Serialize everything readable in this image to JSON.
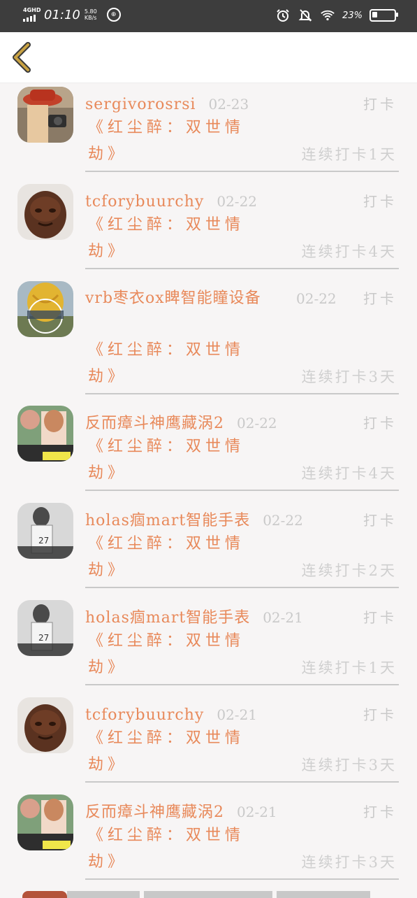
{
  "status_bar": {
    "network": "4GHD",
    "time": "01:10",
    "speed_value": "5.80",
    "speed_unit": "KB/s",
    "battery": "23"
  },
  "header": {
    "back_icon": "chevron-left-icon"
  },
  "entries": [
    {
      "user": "sergivorosrsi",
      "date": "02-23",
      "action": "打卡",
      "book_line1": "《红尘醉：双世情",
      "book_line2": "劫》",
      "streak": "连续打卡1天",
      "avatar": "red-hat-camera"
    },
    {
      "user": "tcforybuurchy",
      "date": "02-22",
      "action": "打卡",
      "book_line1": "《红尘醉：双世情",
      "book_line2": "劫》",
      "streak": "连续打卡4天",
      "avatar": "bronze-buddha"
    },
    {
      "user": "vrb枣衣ox睥智能瞳设备",
      "date": "02-22",
      "action": "打卡",
      "book_line1": "《红尘醉：双世情",
      "book_line2": "劫》",
      "streak": "连续打卡3天",
      "avatar": "hot-air-balloon"
    },
    {
      "user": "反而瘴斗神鹰藏涡2",
      "date": "02-22",
      "action": "打卡",
      "book_line1": "《红尘醉：双世情",
      "book_line2": "劫》",
      "streak": "连续打卡4天",
      "avatar": "girl-flowers"
    },
    {
      "user": "holas痼mart智能手表",
      "date": "02-22",
      "action": "打卡",
      "book_line1": "《红尘醉：双世情",
      "book_line2": "劫》",
      "streak": "连续打卡2天",
      "avatar": "player-27"
    },
    {
      "user": "holas痼mart智能手表",
      "date": "02-21",
      "action": "打卡",
      "book_line1": "《红尘醉：双世情",
      "book_line2": "劫》",
      "streak": "连续打卡1天",
      "avatar": "player-27"
    },
    {
      "user": "tcforybuurchy",
      "date": "02-21",
      "action": "打卡",
      "book_line1": "《红尘醉：双世情",
      "book_line2": "劫》",
      "streak": "连续打卡3天",
      "avatar": "bronze-buddha"
    },
    {
      "user": "反而瘴斗神鹰藏涡2",
      "date": "02-21",
      "action": "打卡",
      "book_line1": "《红尘醉：双世情",
      "book_line2": "劫》",
      "streak": "连续打卡3天",
      "avatar": "girl-flowers"
    }
  ],
  "colors": {
    "accent": "#e8895a",
    "muted": "#c9c9c9",
    "back": "#c9a243"
  }
}
